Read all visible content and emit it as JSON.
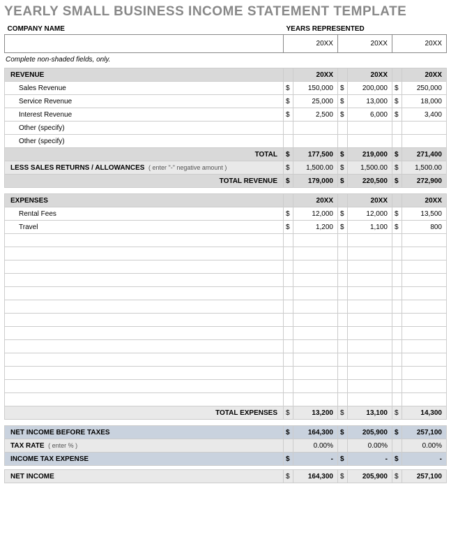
{
  "title": "YEARLY SMALL BUSINESS INCOME STATEMENT TEMPLATE",
  "header": {
    "company_label": "COMPANY NAME",
    "years_label": "YEARS REPRESENTED",
    "company_value": "",
    "years": [
      "20XX",
      "20XX",
      "20XX"
    ]
  },
  "instruction": "Complete non-shaded fields, only.",
  "cols": [
    "20XX",
    "20XX",
    "20XX"
  ],
  "revenue": {
    "title": "REVENUE",
    "rows": [
      {
        "label": "Sales Revenue",
        "v": [
          "150,000",
          "200,000",
          "250,000"
        ]
      },
      {
        "label": "Service Revenue",
        "v": [
          "25,000",
          "13,000",
          "18,000"
        ]
      },
      {
        "label": "Interest Revenue",
        "v": [
          "2,500",
          "6,000",
          "3,400"
        ]
      },
      {
        "label": "Other (specify)",
        "v": [
          "",
          "",
          ""
        ]
      },
      {
        "label": "Other (specify)",
        "v": [
          "",
          "",
          ""
        ]
      }
    ],
    "total_label": "TOTAL",
    "total": [
      "177,500",
      "219,000",
      "271,400"
    ],
    "less_label": "LESS SALES RETURNS / ALLOWANCES",
    "less_note": "( enter \"-\" negative amount )",
    "less": [
      "1,500.00",
      "1,500.00",
      "1,500.00"
    ],
    "total_rev_label": "TOTAL REVENUE",
    "total_rev": [
      "179,000",
      "220,500",
      "272,900"
    ]
  },
  "expenses": {
    "title": "EXPENSES",
    "rows": [
      {
        "label": "Rental Fees",
        "v": [
          "12,000",
          "12,000",
          "13,500"
        ]
      },
      {
        "label": "Travel",
        "v": [
          "1,200",
          "1,100",
          "800"
        ]
      }
    ],
    "blank_rows": 13,
    "total_label": "TOTAL EXPENSES",
    "total": [
      "13,200",
      "13,100",
      "14,300"
    ]
  },
  "summary": {
    "nibt_label": "NET INCOME BEFORE TAXES",
    "nibt": [
      "164,300",
      "205,900",
      "257,100"
    ],
    "tax_rate_label": "TAX RATE",
    "tax_rate_note": "( enter % )",
    "tax_rate": [
      "0.00%",
      "0.00%",
      "0.00%"
    ],
    "tax_exp_label": "INCOME TAX EXPENSE",
    "tax_exp": [
      "-",
      "-",
      "-"
    ],
    "net_label": "NET INCOME",
    "net": [
      "164,300",
      "205,900",
      "257,100"
    ]
  },
  "currency": "$"
}
